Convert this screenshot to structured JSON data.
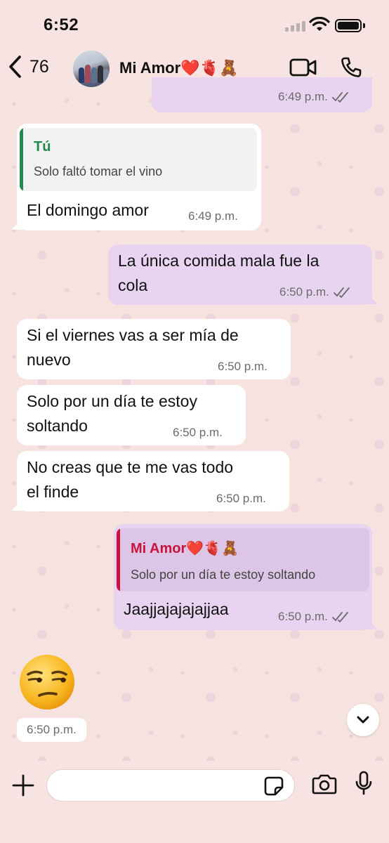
{
  "status_bar": {
    "time": "6:52"
  },
  "header": {
    "back_count": "76",
    "contact_name": "Mi Amor❤️🫀🧸"
  },
  "messages": [
    {
      "id": "m0",
      "direction": "outgoing",
      "time": "6:49 p.m.",
      "read": true
    },
    {
      "id": "m1",
      "direction": "incoming",
      "quote_author": "Tú",
      "quote_text": "Solo faltó tomar el vino",
      "text": "El domingo amor",
      "time": "6:49 p.m."
    },
    {
      "id": "m2",
      "direction": "outgoing",
      "text_line1": "La única comida mala fue la",
      "text_line2": "cola",
      "time": "6:50 p.m.",
      "read": true
    },
    {
      "id": "m3",
      "direction": "incoming",
      "text_line1": "Si el viernes vas a ser mía de",
      "text_line2": "nuevo",
      "time": "6:50 p.m."
    },
    {
      "id": "m4",
      "direction": "incoming",
      "text_line1": "Solo por un día te estoy",
      "text_line2": "soltando",
      "time": "6:50 p.m."
    },
    {
      "id": "m5",
      "direction": "incoming",
      "text_line1": "No creas que te me vas todo",
      "text_line2": "el finde",
      "time": "6:50 p.m."
    },
    {
      "id": "m6",
      "direction": "outgoing",
      "quote_author": "Mi Amor❤️🫀🧸",
      "quote_text": "Solo por un día te estoy soltando",
      "text": "Jaajjajajajajjaa",
      "time": "6:50 p.m.",
      "read": true
    },
    {
      "id": "m7",
      "direction": "incoming",
      "emoji": "unamused-face",
      "time": "6:50 p.m."
    }
  ],
  "input": {
    "placeholder": ""
  },
  "colors": {
    "background": "#f7e4e2",
    "outgoing_bubble": "#e8d4f0",
    "incoming_bubble": "#ffffff",
    "quote_self": "#1f8a4c",
    "quote_contact": "#c8143c",
    "ticks": "#6b6b6b"
  }
}
